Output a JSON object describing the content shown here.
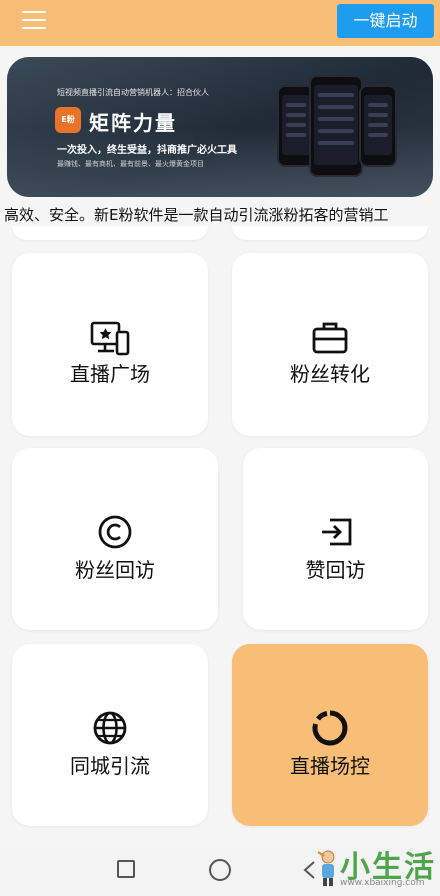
{
  "header": {
    "start_button": "一键启动",
    "menu_icon": "hamburger-menu-icon"
  },
  "banner": {
    "top_text": "短视频直播引流自动营销机器人：招合伙人",
    "logo_text": "E粉",
    "title": "矩阵力量",
    "slogan": "一次投入，终生受益，抖商推广必火工具",
    "subline": "最赚钱、最有商机、最有前景、最火爆黄金项目",
    "active_dot": 2,
    "dot_count": 3
  },
  "marquee_text": "高效、安全。新E粉软件是一款自动引流涨粉拓客的营销工",
  "grid": [
    {
      "label": "直播广场",
      "icon": "live-broadcast-icon",
      "active": false
    },
    {
      "label": "粉丝转化",
      "icon": "briefcase-icon",
      "active": false
    },
    {
      "label": "粉丝回访",
      "icon": "copyright-icon",
      "active": false
    },
    {
      "label": "赞回访",
      "icon": "exit-arrow-icon",
      "active": false
    },
    {
      "label": "同城引流",
      "icon": "globe-icon",
      "active": false
    },
    {
      "label": "直播场控",
      "icon": "loading-ring-icon",
      "active": true
    }
  ],
  "colors": {
    "accent": "#f8bd76",
    "button": "#1e9cf0"
  },
  "watermark": {
    "text": "小生活",
    "url": "www.xbaixing.com"
  }
}
